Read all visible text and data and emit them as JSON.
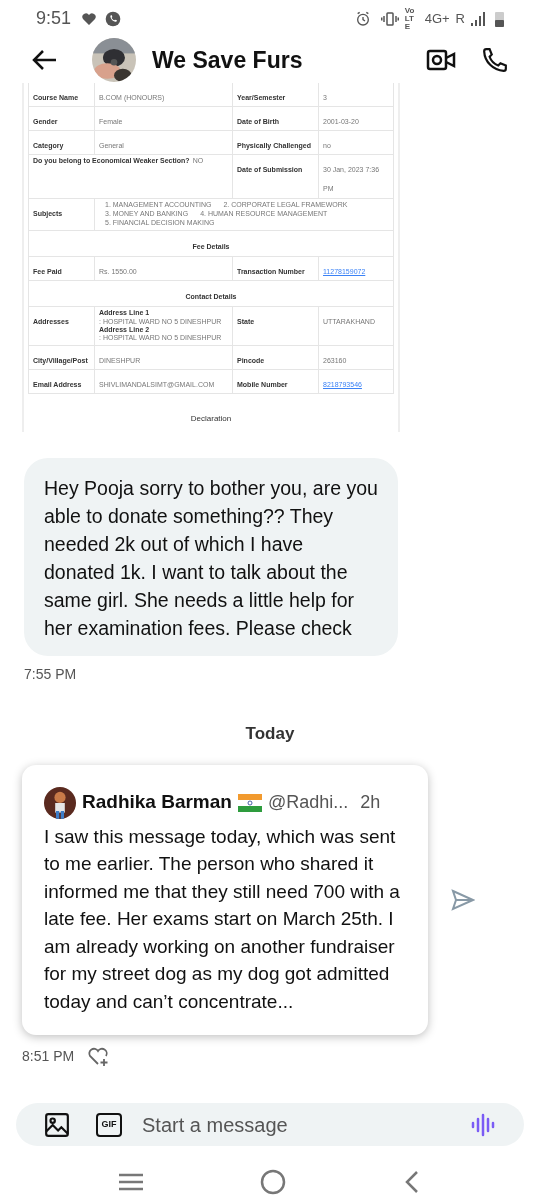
{
  "status_bar": {
    "time": "9:51",
    "indicators": [
      "VoLTE",
      "4G+",
      "R"
    ]
  },
  "header": {
    "title": "We Save Furs"
  },
  "document": {
    "rows": [
      {
        "kind": "pair",
        "label": "Course Name",
        "value": "B.COM (HONOURS)",
        "label_2": "Year/Semester",
        "value_2": "3",
        "value_2_link": false
      },
      {
        "kind": "pair",
        "label": "Gender",
        "value": "Female",
        "label_2": "Date of Birth",
        "value_2": "2001-03-20",
        "value_2_link": false
      },
      {
        "kind": "pair",
        "label": "Category",
        "value": "General",
        "label_2": "Physically Challenged",
        "value_2": "no",
        "value_2_link": false
      },
      {
        "kind": "question",
        "question": "Do you belong to Economical Weaker Section?",
        "answer": "NO",
        "label_2": "Date of Submission",
        "value_2": "30 Jan, 2023 7:36 PM"
      },
      {
        "kind": "list",
        "label": "Subjects",
        "items": [
          "1. MANAGEMENT ACCOUNTING",
          "2. CORPORATE LEGAL FRAMEWORK",
          "3. MONEY AND BANKING",
          "4. HUMAN RESOURCE MANAGEMENT",
          "5. FINANCIAL DECISION MAKING"
        ]
      },
      {
        "kind": "section",
        "title": "Fee Details"
      },
      {
        "kind": "pair",
        "label": "Fee Paid",
        "value": "Rs. 1550.00",
        "label_2": "Transaction Number",
        "value_2": "11278159072",
        "value_2_link": true
      },
      {
        "kind": "section",
        "title": "Contact Details"
      },
      {
        "kind": "addresses",
        "label": "Addresses",
        "lines": [
          {
            "label": "Address Line 1",
            "value": ": HOSPITAL WARD NO 5 DINESHPUR"
          },
          {
            "label": "Address Line 2",
            "value": ": HOSPITAL WARD NO 5 DINESHPUR"
          }
        ],
        "label_2": "State",
        "value_2": "UTTARAKHAND"
      },
      {
        "kind": "pair",
        "label": "City/Village/Post",
        "value": "DINESHPUR",
        "label_2": "Pincode",
        "value_2": "263160",
        "value_2_link": false
      },
      {
        "kind": "pair",
        "label": "Email Address",
        "value": "SHIVLIMANDALSIMT@GMAIL.COM",
        "label_2": "Mobile Number",
        "value_2": "8218793546",
        "value_2_link": true
      }
    ],
    "footer_title": "Declaration"
  },
  "messages": [
    {
      "kind": "text",
      "text": "Hey Pooja sorry to bother you, are you able to donate something?? They needed 2k out of which I have donated 1k. I want to talk about the same girl. She needs a little help for her examination fees. Please check",
      "time": "7:55 PM"
    }
  ],
  "day_separator": "Today",
  "shared_post": {
    "author": "Radhika Barman",
    "handle": "@Radhi...",
    "age": "2h",
    "text": "I saw this message today, which was sent to me earlier. The person who shared it informed me that they still need 700 with a late fee. Her exams start on March 25th. I am already working on another fundraiser for my street dog as my dog got admitted today and can’t concentrate...",
    "time": "8:51 PM"
  },
  "composer": {
    "placeholder": "Start a message",
    "gif_label": "GIF"
  }
}
